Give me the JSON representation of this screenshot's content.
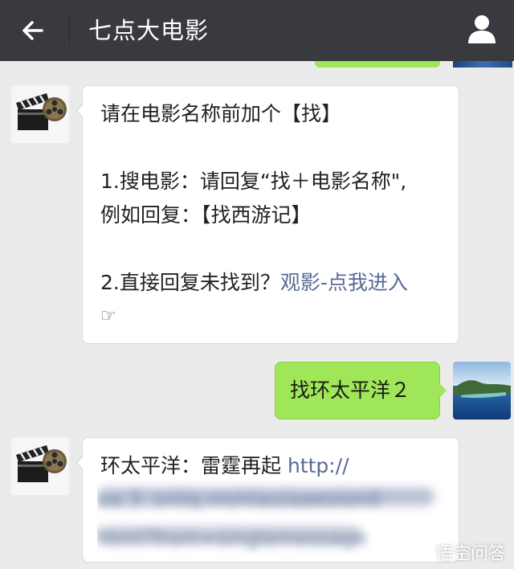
{
  "header": {
    "title": "七点大电影",
    "back_icon": "arrow-left-icon",
    "user_icon": "person-icon"
  },
  "messages": [
    {
      "side": "incoming",
      "lines": [
        "请在电影名称前加个【找】",
        "",
        "1.搜电影：请回复“找＋电影名称\",",
        "例如回复：【找西游记】",
        "",
        "2.直接回复未找到？"
      ],
      "link_text": "观影-点我进入",
      "trailing_icon": "☞"
    },
    {
      "side": "outgoing",
      "text": "找环太平洋２"
    },
    {
      "side": "incoming",
      "prefix": "环太平洋：雷霆再起 ",
      "link_text": "http://",
      "blurred_lines": [
        "aa.3..sniiq.nn/nlauiaaeoion0",
        "html?from=singlemessage"
      ]
    }
  ],
  "watermark": {
    "text": "悟空问答",
    "icon": "wukong-logo-icon"
  },
  "colors": {
    "topbar": "#393a3f",
    "background": "#ebebeb",
    "outgoing_bubble": "#9fe658",
    "link": "#576b95"
  }
}
